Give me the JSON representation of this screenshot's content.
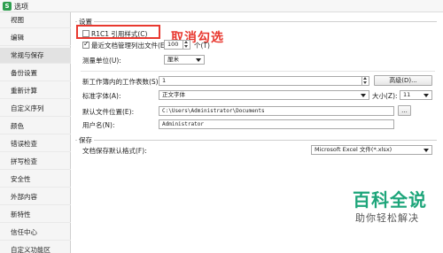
{
  "window": {
    "title": "选项",
    "icon": "app-icon"
  },
  "sidebar": {
    "items": [
      {
        "label": "视图",
        "active": false
      },
      {
        "label": "编辑",
        "active": false
      },
      {
        "label": "常规与保存",
        "active": true
      },
      {
        "label": "备份设置",
        "active": false
      },
      {
        "label": "重新计算",
        "active": false
      },
      {
        "label": "自定义序列",
        "active": false
      },
      {
        "label": "颜色",
        "active": false
      },
      {
        "label": "错误检查",
        "active": false
      },
      {
        "label": "拼写检查",
        "active": false
      },
      {
        "label": "安全性",
        "active": false
      },
      {
        "label": "外部内容",
        "active": false
      },
      {
        "label": "新特性",
        "active": false
      },
      {
        "label": "信任中心",
        "active": false
      },
      {
        "label": "自定义功能区",
        "active": false
      }
    ]
  },
  "settings": {
    "section_label": "设置",
    "r1c1": {
      "label": "R1C1 引用样式(C)",
      "checked": false
    },
    "recent": {
      "label": "最近文档管理列出文件(E)",
      "checked": true,
      "value": "100",
      "unit": "个(T)"
    },
    "unit": {
      "label": "测量单位(U):",
      "value": "厘米"
    },
    "sheets": {
      "label": "新工作簿内的工作表数(S):",
      "value": "1"
    },
    "advanced_button": "高级(D)...",
    "font": {
      "label": "标准字体(A):",
      "value": "正文字体"
    },
    "size": {
      "label": "大小(Z):",
      "value": "11"
    },
    "location": {
      "label": "默认文件位置(E):",
      "value": "C:\\Users\\Administrator\\Documents",
      "browse": "..."
    },
    "username": {
      "label": "用户名(N):",
      "value": "Administrator"
    }
  },
  "save": {
    "section_label": "保存",
    "format": {
      "label": "文档保存默认格式(F):",
      "value": "Microsoft Excel 文件(*.xlsx)"
    }
  },
  "annotation": {
    "text": "取消勾选",
    "color": "#e8382f"
  },
  "watermark": {
    "title": "百科全说",
    "subtitle": "助你轻松解决",
    "color": "#1da57a"
  }
}
